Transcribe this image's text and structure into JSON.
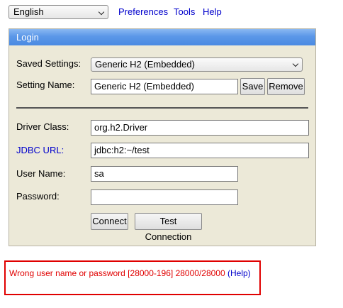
{
  "topbar": {
    "language": "English",
    "links": [
      "Preferences",
      "Tools",
      "Help"
    ]
  },
  "login": {
    "title": "Login",
    "saved_settings_label": "Saved Settings:",
    "saved_settings_value": "Generic H2 (Embedded)",
    "setting_name_label": "Setting Name:",
    "setting_name_value": "Generic H2 (Embedded)",
    "save_label": "Save",
    "remove_label": "Remove",
    "driver_class_label": "Driver Class:",
    "driver_class_value": "org.h2.Driver",
    "jdbc_url_label": "JDBC URL:",
    "jdbc_url_value": "jdbc:h2:~/test",
    "user_name_label": "User Name:",
    "user_name_value": "sa",
    "password_label": "Password:",
    "password_value": "",
    "connect_label": "Connect",
    "test_connection_label": "Test Connection"
  },
  "error": {
    "message": "Wrong user name or password [28000-196] 28000/28000",
    "help_link": "(Help)"
  },
  "colors": {
    "header_blue": "#4a8ae2",
    "panel_bg": "#ece9d8",
    "link_blue": "#0000cc",
    "error_red": "#e00000"
  }
}
